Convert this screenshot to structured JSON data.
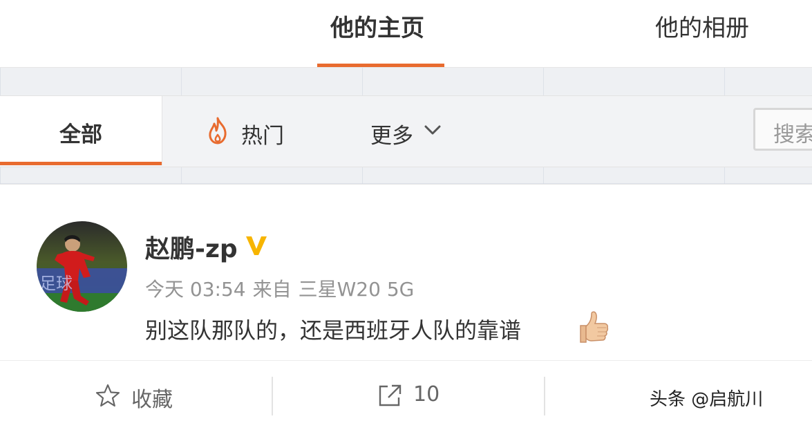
{
  "nav": {
    "tab_home": "他的主页",
    "tab_album": "他的相册"
  },
  "filters": {
    "all": "全部",
    "hot": "热门",
    "more": "更多",
    "search_placeholder": "搜索"
  },
  "post": {
    "username": "赵鹏-zp",
    "verified": true,
    "time": "今天 03:54",
    "source_prefix": "来自",
    "source": "三星W20 5G",
    "content": "别这队那队的，还是西班牙人队的靠谱",
    "emoji": "thumbs-up-icon"
  },
  "actions": {
    "favorite": "收藏",
    "share_count": "10"
  },
  "watermark": "头条 @启航川",
  "colors": {
    "accent": "#e86b2f",
    "verified": "#f7b500"
  }
}
